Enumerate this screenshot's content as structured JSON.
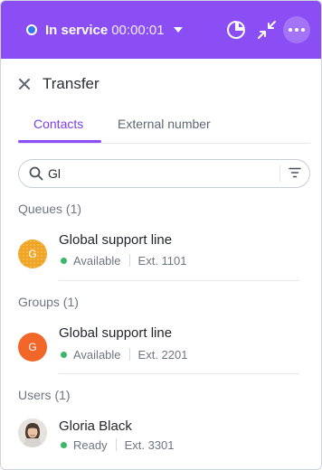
{
  "colors": {
    "brand": "#8b4df4",
    "status_in_service": "#2f7af0",
    "available": "#39b86a",
    "queue_avatar": "#f0a424",
    "group_avatar": "#f2662a"
  },
  "header": {
    "status_label": "In service",
    "timer": "00:00:01",
    "icons": [
      "status-indicator-icon",
      "chevron-down-icon",
      "pie-chart-icon",
      "minimize-icon",
      "more-icon"
    ]
  },
  "dialog": {
    "title": "Transfer"
  },
  "tabs": [
    {
      "label": "Contacts",
      "active": true
    },
    {
      "label": "External number",
      "active": false
    }
  ],
  "search": {
    "value": "Gl",
    "placeholder": ""
  },
  "queues": {
    "title": "Queues (1)",
    "items": [
      {
        "initial": "G",
        "name": "Global support line",
        "status": "Available",
        "ext": "Ext. 1101"
      }
    ]
  },
  "groups": {
    "title": "Groups (1)",
    "items": [
      {
        "initial": "G",
        "name": "Global support line",
        "status": "Available",
        "ext": "Ext. 2201"
      }
    ]
  },
  "users": {
    "title": "Users (1)",
    "items": [
      {
        "name": "Gloria Black",
        "status": "Ready",
        "ext": "Ext. 3301"
      }
    ]
  }
}
